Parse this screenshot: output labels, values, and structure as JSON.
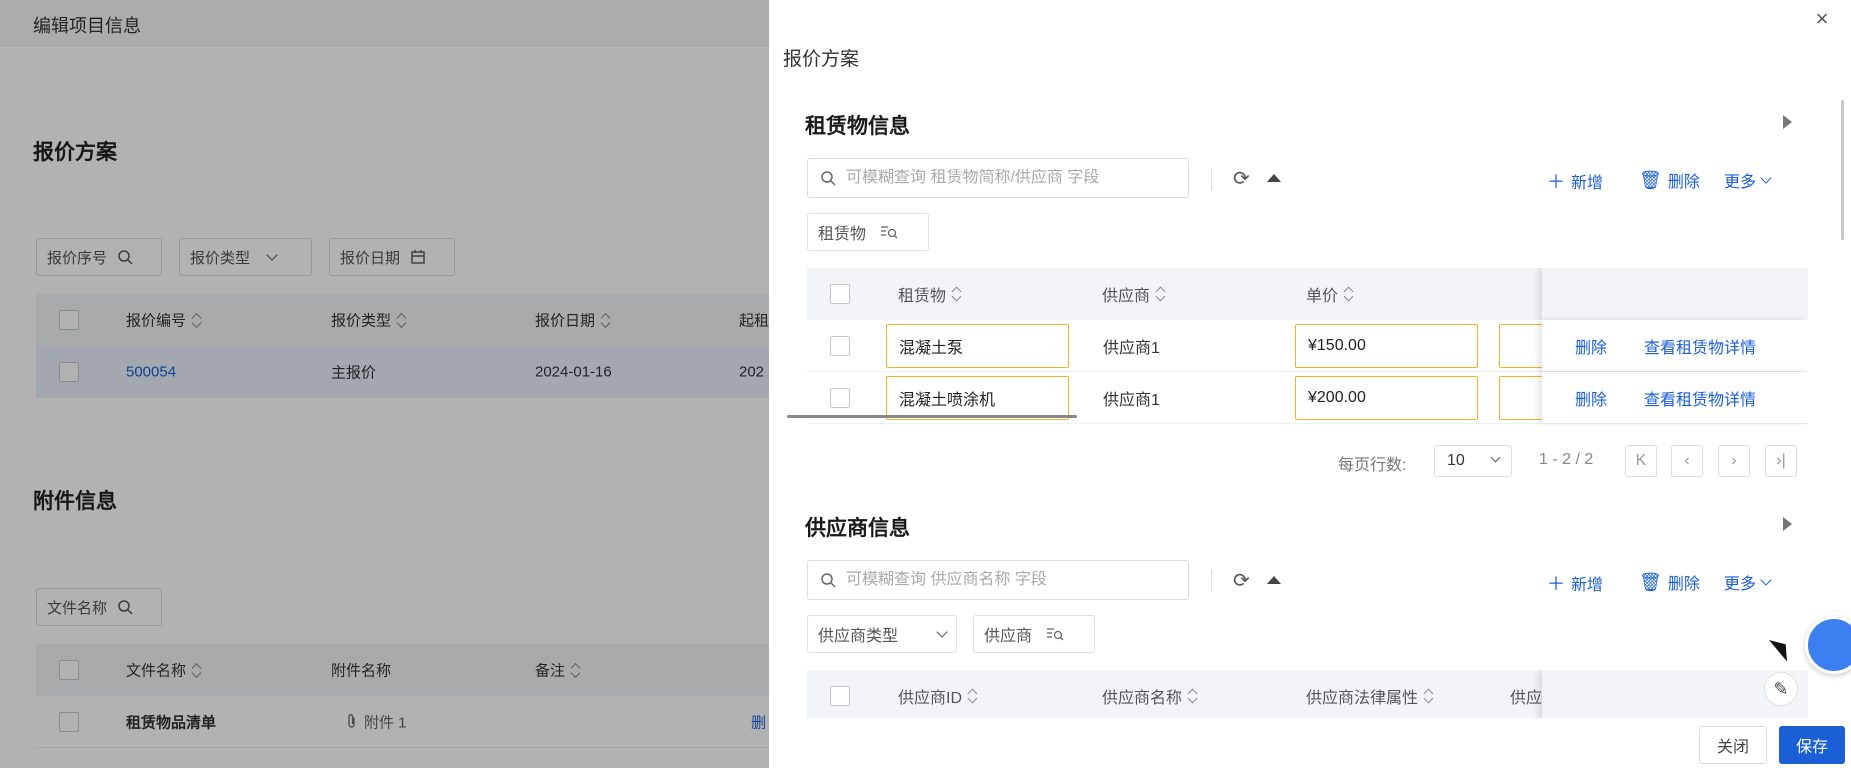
{
  "background": {
    "header_title": "编辑项目信息",
    "quote_section": {
      "title": "报价方案",
      "filters": [
        {
          "label": "报价序号",
          "icon": "search-icon"
        },
        {
          "label": "报价类型",
          "icon": "chevron-down-icon"
        },
        {
          "label": "报价日期",
          "icon": "calendar-icon"
        }
      ],
      "columns": [
        "报价编号",
        "报价类型",
        "报价日期",
        "起租"
      ],
      "rows": [
        {
          "id": "500054",
          "type": "主报价",
          "date": "2024-01-16",
          "start": "202"
        }
      ]
    },
    "attachment_section": {
      "title": "附件信息",
      "filter_label": "文件名称",
      "columns": [
        "文件名称",
        "附件名称",
        "备注"
      ],
      "rows": [
        {
          "file_name": "租赁物品清单",
          "attachment": "附件 1",
          "action": "删"
        }
      ]
    }
  },
  "drawer": {
    "title": "报价方案",
    "close_icon": "×",
    "lease_section": {
      "title": "租赁物信息",
      "search_placeholder": "可模糊查询 租赁物简称/供应商 字段",
      "add_label": "新增",
      "delete_label": "删除",
      "more_label": "更多",
      "filter_chip": "租赁物",
      "columns": [
        "租赁物",
        "供应商",
        "单价"
      ],
      "rows": [
        {
          "item": "混凝土泵",
          "supplier": "供应商1",
          "price": "¥150.00",
          "delete": "删除",
          "view": "查看租赁物详情"
        },
        {
          "item": "混凝土喷涂机",
          "supplier": "供应商1",
          "price": "¥200.00",
          "delete": "删除",
          "view": "查看租赁物详情"
        }
      ],
      "pager": {
        "rows_label": "每页行数:",
        "rows_per_page": "10",
        "range": "1 - 2 / 2"
      }
    },
    "supplier_section": {
      "title": "供应商信息",
      "search_placeholder": "可模糊查询 供应商名称 字段",
      "add_label": "新增",
      "delete_label": "删除",
      "more_label": "更多",
      "filter_type": "供应商类型",
      "filter_chip": "供应商",
      "columns": [
        "供应商ID",
        "供应商名称",
        "供应商法律属性",
        "供应"
      ]
    },
    "footer": {
      "close_label": "关闭",
      "save_label": "保存"
    }
  },
  "colors": {
    "accent": "#1a5fd6",
    "edit_border": "#f2b02c",
    "header_bg": "#f2f4f7"
  }
}
